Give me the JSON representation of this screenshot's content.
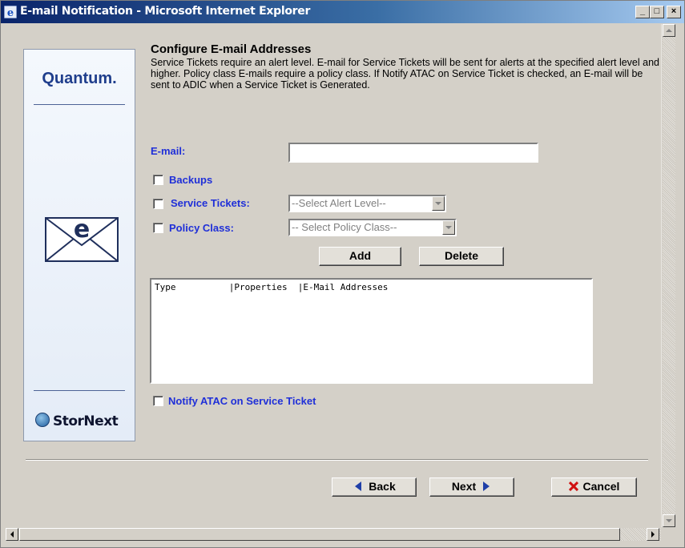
{
  "window": {
    "title": "E-mail Notification - Microsoft Internet Explorer",
    "minimize": "_",
    "maximize": "□",
    "close": "×"
  },
  "sidebar": {
    "top_logo": "Quantum.",
    "bottom_logo": "StorNext",
    "envelope_letter": "e"
  },
  "main": {
    "heading": "Configure E-mail Addresses",
    "description": "Service Tickets require an alert level. E-mail for Service Tickets will be sent for alerts at the specified alert level and higher. Policy class E-mails require a policy class. If Notify ATAC on Service Ticket is checked, an E-mail will be sent to ADIC when a Service Ticket is Generated.",
    "email_label": "E-mail:",
    "email_value": "",
    "backups_label": "Backups",
    "service_tickets_label": "Service Tickets:",
    "alert_level_placeholder": "--Select Alert Level--",
    "policy_class_label": "Policy Class:",
    "policy_class_placeholder": "-- Select Policy Class--",
    "add_button": "Add",
    "delete_button": "Delete",
    "list_header": "Type          |Properties  |E-Mail Addresses",
    "notify_label": "Notify ATAC on Service Ticket"
  },
  "footer": {
    "back_button": "Back",
    "next_button": "Next",
    "cancel_button": "Cancel"
  },
  "colors": {
    "label_blue": "#1f2fd8",
    "title_start": "#0a246a",
    "title_end": "#a6caf0",
    "arrow_blue": "#1f3fa8",
    "cancel_red": "#d01010"
  }
}
